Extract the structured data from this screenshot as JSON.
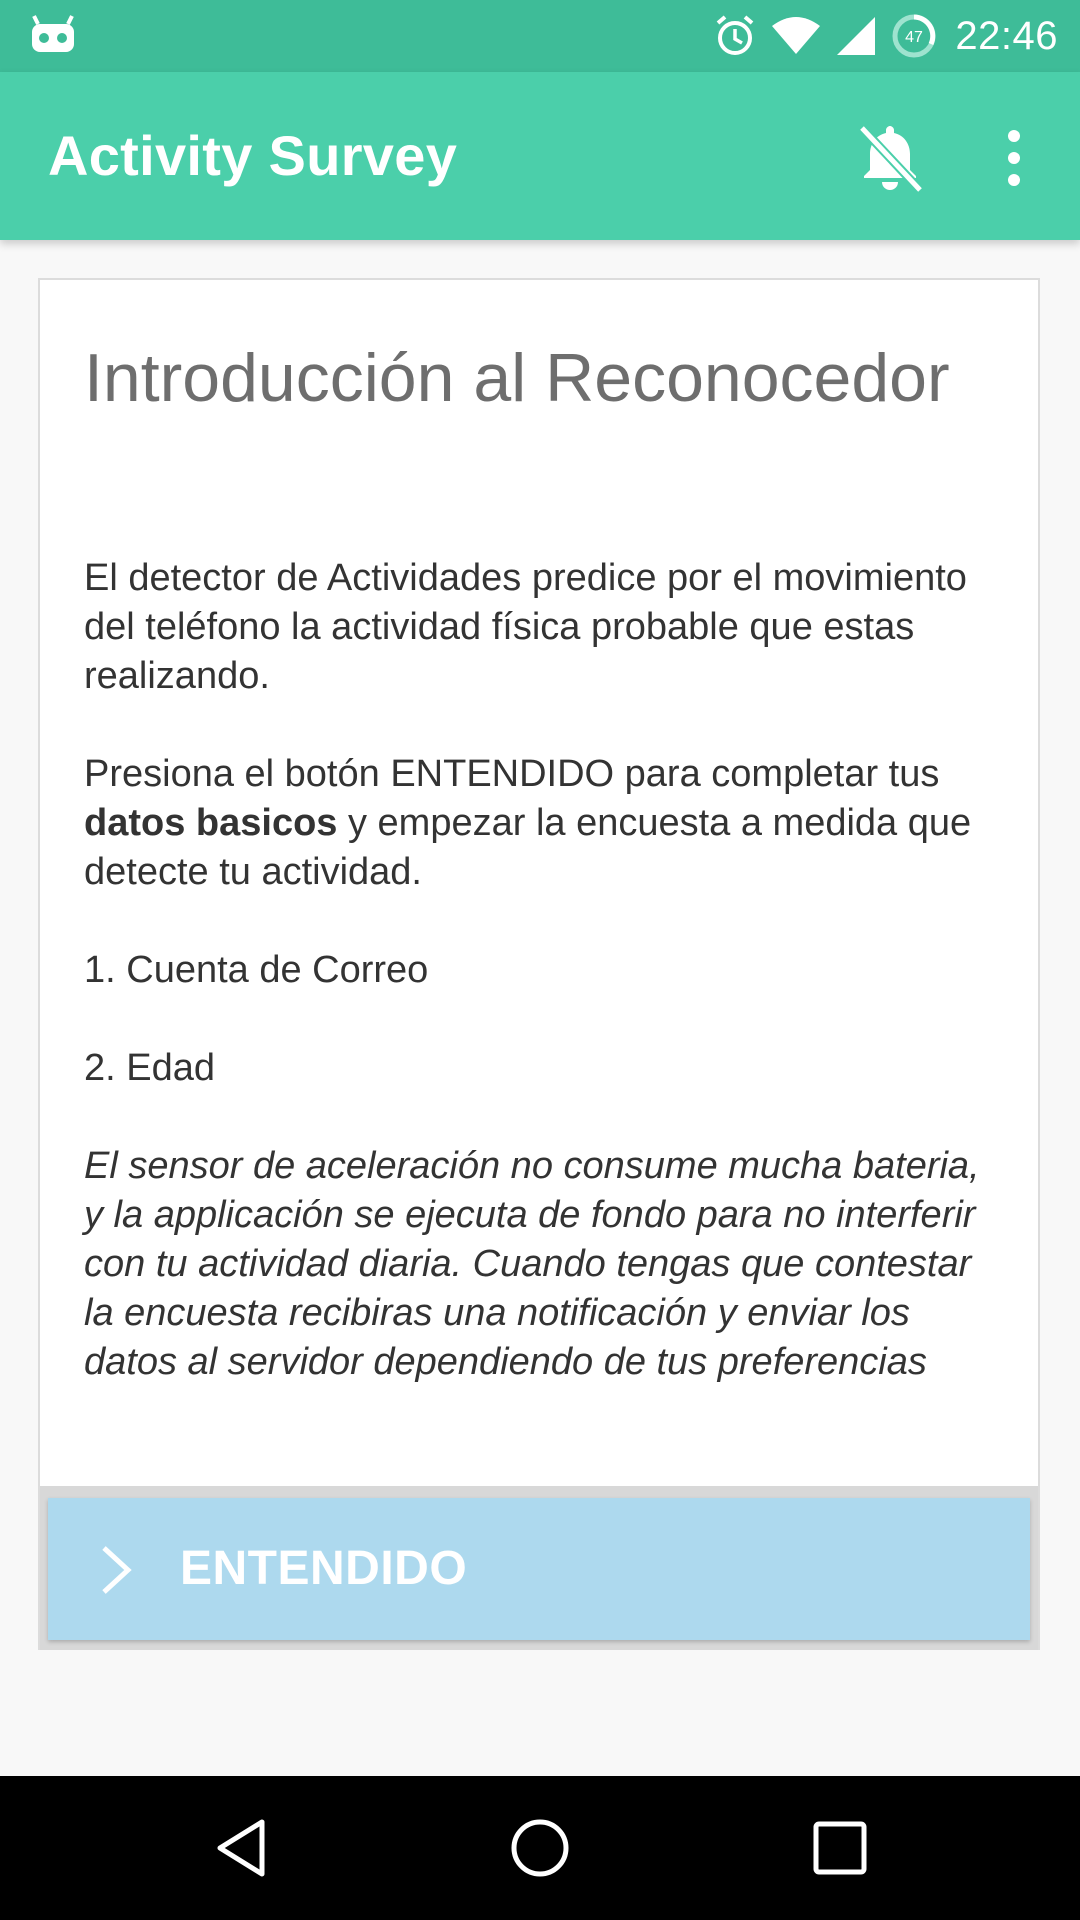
{
  "status_bar": {
    "time": "22:46",
    "battery_level": "47",
    "icons": [
      "notification-app-icon",
      "alarm-icon",
      "wifi-icon",
      "signal-icon",
      "battery-icon"
    ]
  },
  "app_bar": {
    "title": "Activity Survey",
    "actions": [
      "notifications-off-icon",
      "more-vert-icon"
    ],
    "color": "#4bcfaa"
  },
  "card": {
    "title": "Introducción al Reconocedor",
    "paragraph_1": "El detector de Actividades predice por el movimiento del teléfono la actividad física probable que estas realizando.",
    "paragraph_2_before": "Presiona el botón ENTENDIDO para completar tus ",
    "paragraph_2_bold": "datos basicos",
    "paragraph_2_after": " y empezar la encuesta a medida que detecte tu actividad.",
    "item_1": "1. Cuenta de Correo",
    "item_2": "2. Edad",
    "note": "El sensor de aceleración no consume mucha bateria, y la applicación se ejecuta de fondo para no interferir con tu actividad diaria. Cuando tengas que contestar la encuesta recibiras una notificación y enviar los datos al servidor dependiendo de tus preferencias",
    "button_label": "ENTENDIDO",
    "button_color": "#add9ee"
  },
  "nav_bar": {
    "buttons": [
      "back-icon",
      "home-icon",
      "recents-icon"
    ]
  }
}
